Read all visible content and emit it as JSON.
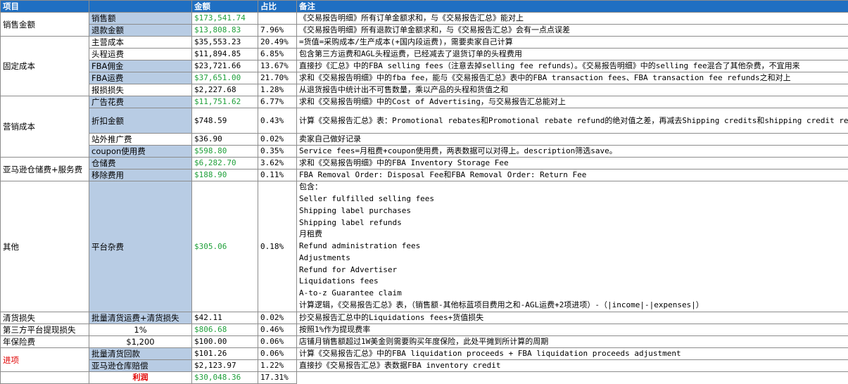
{
  "header": {
    "c1": "项目",
    "c2": "",
    "c3": "金额",
    "c4": "占比",
    "c5": "备注"
  },
  "groups": {
    "sales": "销售金额",
    "fixed": "固定成本",
    "marketing": "营销成本",
    "amazon": "亚马逊仓储费+服务费",
    "other": "其他",
    "clearance": "清货损失",
    "withdraw": "第三方平台提现损失",
    "insurance": "年保险费",
    "income": "进项"
  },
  "rows": [
    {
      "item": "销售额",
      "amount": "$173,541.74",
      "pct": "",
      "note": "《交易报告明细》所有订单金额求和，与《交易报告汇总》能对上"
    },
    {
      "item": "退款金额",
      "amount": "$13,808.83",
      "pct": "7.96%",
      "note": "《交易报告明细》所有退款订单金额求和，与《交易报告汇总》会有一点点误差"
    },
    {
      "item": "主营成本",
      "amount": "$35,553.23",
      "pct": "20.49%",
      "note": "=货值=采购成本/生产成本(+国内段运费)，需要卖家自己计算"
    },
    {
      "item": "头程运费",
      "amount": "$11,894.85",
      "pct": "6.85%",
      "note": "包含第三方运费和AGL头程运费，已经减去了退货订单的头程费用"
    },
    {
      "item": "FBA佣金",
      "amount": "$23,721.66",
      "pct": "13.67%",
      "note": "直接抄《汇总》中的FBA selling fees（注意去掉selling fee refunds）。《交易报告明细》中的selling fee混合了其他杂费，不宜用来"
    },
    {
      "item": "FBA运费",
      "amount": "$37,651.00",
      "pct": "21.70%",
      "note": "求和《交易报告明细》中的fba fee，能与《交易报告汇总》表中的FBA transaction fees、FBA transaction fee refunds之和对上"
    },
    {
      "item": "报损损失",
      "amount": "$2,227.68",
      "pct": "1.28%",
      "note": "从退货报告中统计出不可售数量，乘以产品的头程和货值之和"
    },
    {
      "item": "广告花费",
      "amount": "$11,751.62",
      "pct": "6.77%",
      "note": "求和《交易报告明细》中的Cost of Advertising，与交易报告汇总能对上"
    },
    {
      "item": "折扣金额",
      "amount": "$748.59",
      "pct": "0.43%",
      "note": "计算《交易报告汇总》表：Promotional rebates和Promotional rebate refund的绝对值之差，再减去Shipping credits和shipping credit refunds绝对值之差"
    },
    {
      "item": "站外推广费",
      "amount": "$36.90",
      "pct": "0.02%",
      "note": "卖家自己做好记录"
    },
    {
      "item": "coupon使用费",
      "amount": "$598.80",
      "pct": "0.35%",
      "note": "Service fees=月租费+coupon使用费，两表数据可以对得上。description筛选save。"
    },
    {
      "item": "仓储费",
      "amount": "$6,282.70",
      "pct": "3.62%",
      "note": "求和《交易报告明细》中的FBA Inventory Storage Fee"
    },
    {
      "item": "移除费用",
      "amount": "$188.90",
      "pct": "0.11%",
      "note": "FBA Removal Order: Disposal Fee和FBA Removal Order: Return Fee"
    },
    {
      "item": "平台杂费",
      "amount": "$305.06",
      "pct": "0.18%",
      "note_lines": [
        "包含：",
        "Seller fulfilled selling fees",
        "Shipping label purchases",
        "Shipping label refunds",
        "月租费",
        "Refund administration fees",
        "Adjustments",
        "Refund for Advertiser",
        "Liquidations fees",
        "A-to-z Guarantee claim",
        "计算逻辑，《交易报告汇总》表，（销售额-其他标蓝项目费用之和-AGL运费+2项进项）-（|income|-|expenses|）"
      ]
    },
    {
      "item": "批量清货运费+清货损失",
      "amount": "$42.11",
      "pct": "0.02%",
      "note": "抄交易报告汇总中的Liquidations fees+货值损失"
    },
    {
      "item": "1%",
      "amount": "$806.68",
      "pct": "0.46%",
      "note": "按照1%作为提现费率"
    },
    {
      "item": "$1,200",
      "amount": "$100.00",
      "pct": "0.06%",
      "note": "店铺月销售额超过1W美金则需要购买年度保险，此处平摊到所计算的周期"
    },
    {
      "item": "批量清货回款",
      "amount": "$101.26",
      "pct": "0.06%",
      "note": "计算《交易报告汇总》中的FBA liquidation proceeds + FBA liquidation proceeds adjustment"
    },
    {
      "item": "亚马逊仓库赔偿",
      "amount": "$2,123.97",
      "pct": "1.22%",
      "note": "直接抄《交易报告汇总》表数据FBA inventory credit"
    }
  ],
  "profit": {
    "label": "利润",
    "amount": "$30,048.36",
    "pct": "17.31%"
  },
  "colors": {
    "header": "#1f6fc2",
    "highlight": "#b8cce4",
    "green_text": "#1fa03a",
    "red_text": "#e00000"
  }
}
